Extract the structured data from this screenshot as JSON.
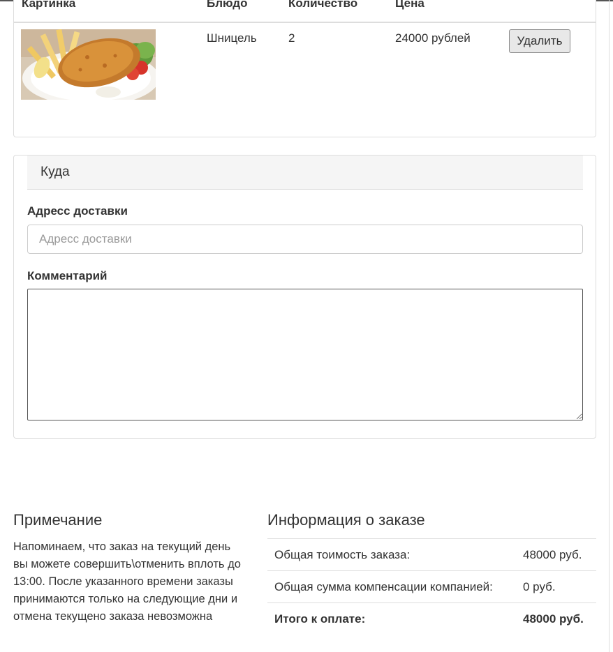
{
  "cart": {
    "headers": [
      "Картинка",
      "Блюдо",
      "Количество",
      "Цена"
    ],
    "items": [
      {
        "image_icon": "schnitzel-photo",
        "dish": "Шницель",
        "quantity": "2",
        "price": "24000 рублей",
        "delete_label": "Удалить"
      }
    ]
  },
  "delivery": {
    "heading": "Куда",
    "address_label": "Адресс доставки",
    "address_placeholder": "Адресс доставки",
    "address_value": "",
    "comment_label": "Комментарий",
    "comment_value": ""
  },
  "note": {
    "title": "Примечание",
    "text": "Напоминаем, что заказ на текущий день вы можете совершить\\отменить вплоть до 13:00. После указанного времени заказы принимаются только на следующие дни и отмена текущено заказа невозможна"
  },
  "order_info": {
    "title": "Информация о заказе",
    "rows": [
      {
        "label": "Общая тоимость заказа:",
        "value": "48000 руб."
      },
      {
        "label": "Общая сумма компенсации компанией:",
        "value": "0 руб."
      },
      {
        "label": "Итого к оплате:",
        "value": "48000 руб."
      }
    ]
  },
  "colors": {
    "border": "#dddddd",
    "heading_bg": "#f5f5f5",
    "text": "#333333"
  }
}
